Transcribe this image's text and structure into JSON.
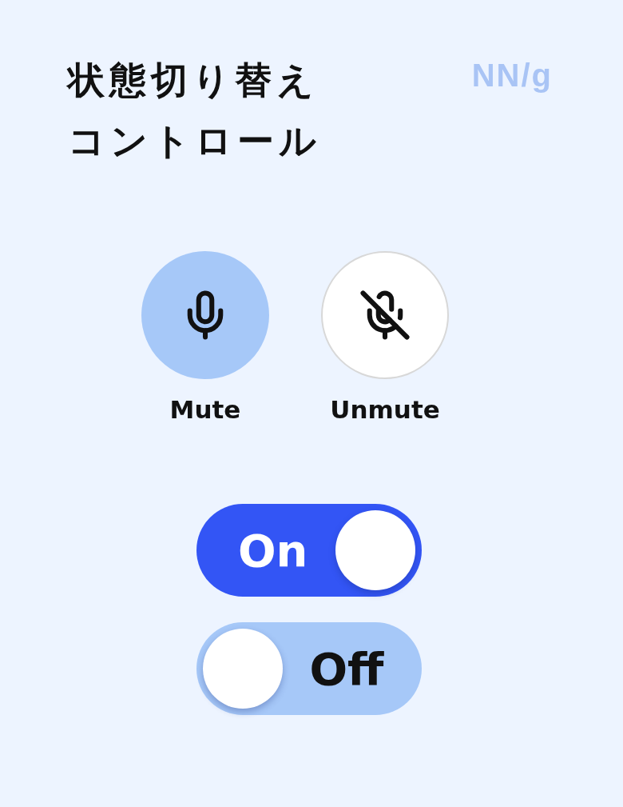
{
  "title": {
    "lines": [
      "状態切り替え",
      "コントロール"
    ]
  },
  "logo": {
    "text": "NN/g"
  },
  "mic_buttons": [
    {
      "label": "Mute",
      "kind": "mic",
      "selected": true
    },
    {
      "label": "Unmute",
      "kind": "mic-off",
      "selected": false
    }
  ],
  "toggles": [
    {
      "label": "On",
      "on": true
    },
    {
      "label": "Off",
      "on": false
    }
  ]
}
